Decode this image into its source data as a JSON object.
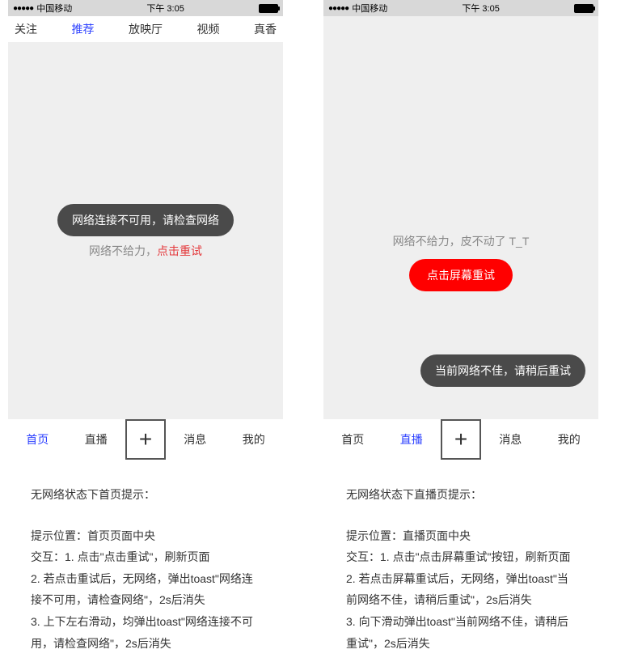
{
  "left": {
    "status": {
      "carrier": "中国移动",
      "time": "下午 3:05",
      "signal": "●●●●●"
    },
    "topTabs": [
      "关注",
      "推荐",
      "放映厅",
      "视频",
      "真香"
    ],
    "topActiveIndex": 1,
    "toastText": "网络连接不可用，请检查网络",
    "retryPrefix": "网络不给力，",
    "retryAction": "点击重试",
    "bottomNav": [
      "首页",
      "直播",
      "消息",
      "我的"
    ],
    "bottomActiveIndex": 0,
    "desc": {
      "title": "无网络状态下首页提示：",
      "lines": [
        "提示位置：首页页面中央",
        "交互：1. 点击\"点击重试\"，刷新页面",
        "           2. 若点击重试后，无网络，弹出toast\"网络连接不可用，请检查网络\"，2s后消失",
        "           3. 上下左右滑动，均弹出toast\"网络连接不可用，请检查网络\"，2s后消失"
      ]
    }
  },
  "right": {
    "status": {
      "carrier": "中国移动",
      "time": "下午 3:05",
      "signal": "●●●●●"
    },
    "retryText": "网络不给力，皮不动了 T_T",
    "redBtn": "点击屏幕重试",
    "toastText": "当前网络不佳，请稍后重试",
    "bottomNav": [
      "首页",
      "直播",
      "消息",
      "我的"
    ],
    "bottomActiveIndex": 1,
    "desc": {
      "title": "无网络状态下直播页提示：",
      "lines": [
        "提示位置：直播页面中央",
        "交互：1. 点击\"点击屏幕重试\"按钮，刷新页面",
        "           2. 若点击屏幕重试后，无网络，弹出toast\"当前网络不佳，请稍后重试\"，2s后消失",
        "           3. 向下滑动弹出toast\"当前网络不佳，请稍后重试\"，2s后消失"
      ]
    }
  }
}
